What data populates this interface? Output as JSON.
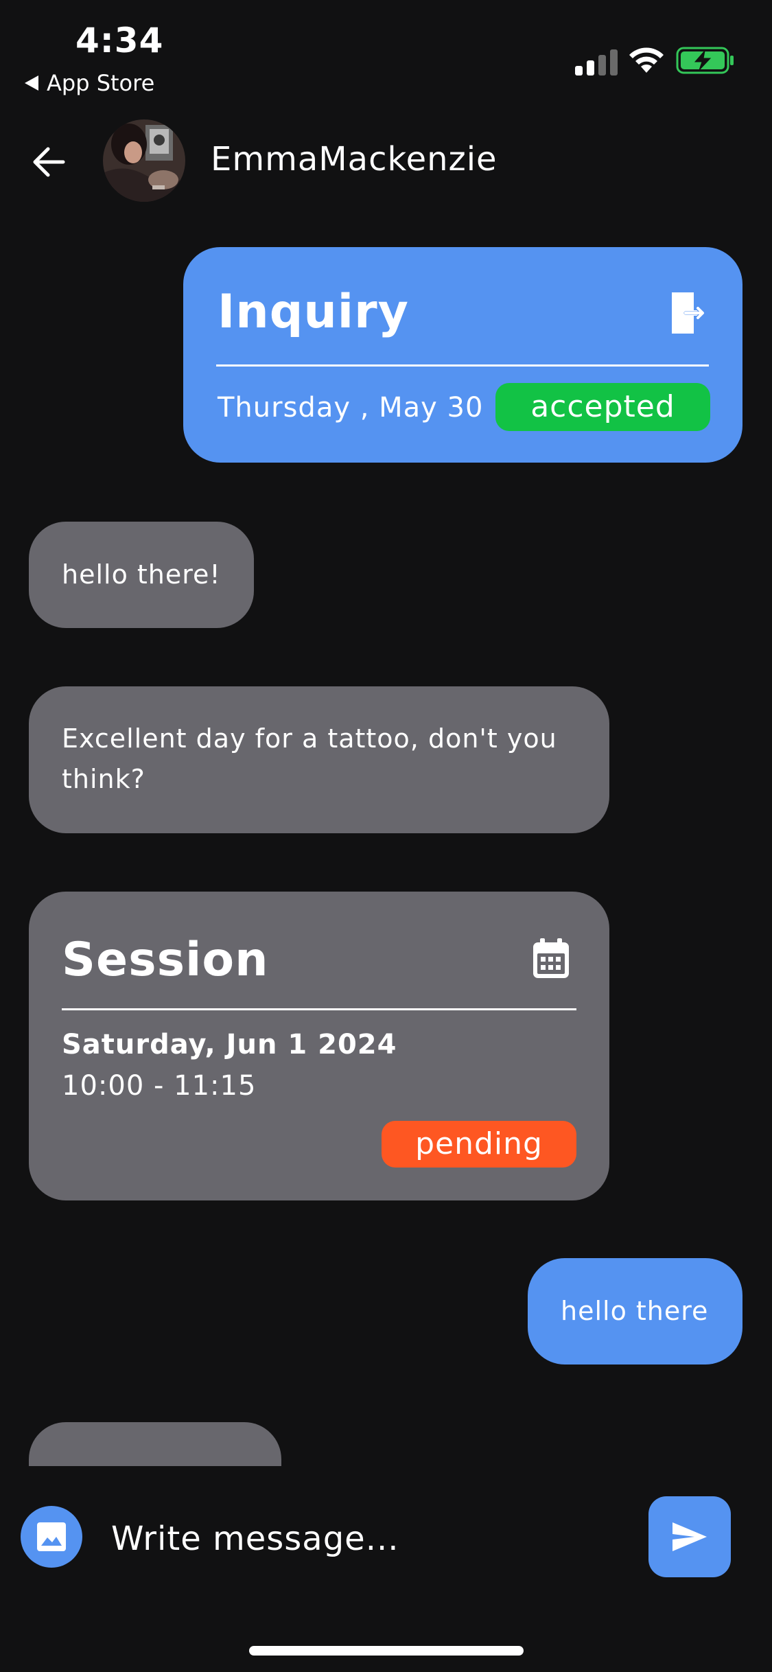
{
  "status_bar": {
    "time": "4:34",
    "back_app_label": "App Store",
    "battery_color": "#34c759"
  },
  "header": {
    "contact_name": "EmmaMackenzie",
    "back_icon": "arrow-left-icon",
    "avatar": "contact-avatar-photo"
  },
  "messages": [
    {
      "type": "inquiry_card",
      "side": "sent",
      "title": "Inquiry",
      "icon": "exit-document-icon",
      "date": "Thursday , May 30",
      "status": "accepted",
      "status_color": "#12c245"
    },
    {
      "type": "text",
      "side": "received",
      "text": "hello there!"
    },
    {
      "type": "text",
      "side": "received",
      "text": "Excellent day for a tattoo, don't you think?"
    },
    {
      "type": "session_card",
      "side": "received",
      "title": "Session",
      "icon": "calendar-icon",
      "date": "Saturday, Jun 1 2024",
      "time_range": "10:00 - 11:15",
      "status": "pending",
      "status_color": "#fe5722"
    },
    {
      "type": "text",
      "side": "sent",
      "text": "hello there"
    },
    {
      "type": "text",
      "side": "received",
      "text": ""
    }
  ],
  "composer": {
    "placeholder": "Write message...",
    "image_icon": "image-icon",
    "send_icon": "send-icon"
  },
  "colors": {
    "background": "#111112",
    "sent_bubble": "#5593f1",
    "received_bubble": "#68676d"
  }
}
